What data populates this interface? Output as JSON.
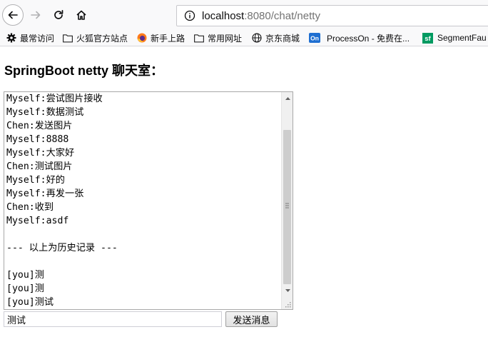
{
  "browser": {
    "url_host": "localhost",
    "url_rest": ":8080/chat/netty"
  },
  "bookmarks": [
    {
      "label": "最常访问",
      "icon": "gear-icon"
    },
    {
      "label": "火狐官方站点",
      "icon": "folder-icon"
    },
    {
      "label": "新手上路",
      "icon": "firefox-icon"
    },
    {
      "label": "常用网址",
      "icon": "folder-icon"
    },
    {
      "label": "京东商城",
      "icon": "globe-icon"
    },
    {
      "label": "ProcessOn - 免费在...",
      "icon": "processon-icon"
    },
    {
      "label": "SegmentFau",
      "icon": "segmentfault-icon"
    }
  ],
  "page": {
    "title": "SpringBoot netty 聊天室："
  },
  "chat": {
    "lines": [
      "Myself:尝试图片接收",
      "Myself:数据测试",
      "Chen:发送图片",
      "Myself:8888",
      "Myself:大家好",
      "Chen:测试图片",
      "Myself:好的",
      "Myself:再发一张",
      "Chen:收到",
      "Myself:asdf",
      "",
      "--- 以上为历史记录 ---",
      "",
      "[you]测",
      "[you]测",
      "[you]测试"
    ]
  },
  "composer": {
    "input_value": "测试",
    "send_label": "发送消息"
  },
  "colors": {
    "toolbar_bg": "#f9f9fa",
    "scroll_thumb": "#cdcdcd",
    "button_bg": "#e6e6e6"
  }
}
